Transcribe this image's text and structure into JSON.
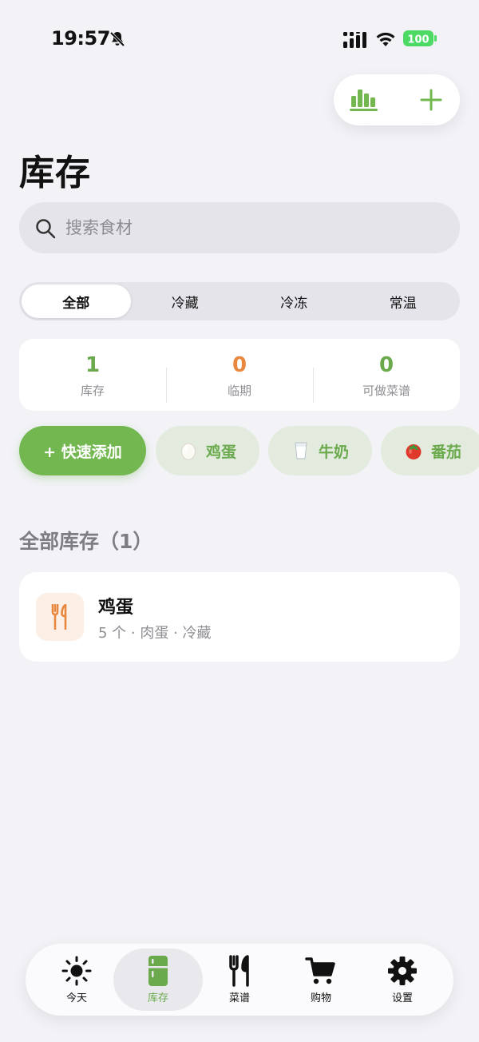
{
  "status_bar": {
    "time": "19:57",
    "battery": "100"
  },
  "page": {
    "title": "库存"
  },
  "search": {
    "placeholder": "搜索食材"
  },
  "segments": [
    {
      "label": "全部",
      "active": true
    },
    {
      "label": "冷藏",
      "active": false
    },
    {
      "label": "冷冻",
      "active": false
    },
    {
      "label": "常温",
      "active": false
    }
  ],
  "stats": [
    {
      "value": "1",
      "label": "库存",
      "color": "#6aaa4c"
    },
    {
      "value": "0",
      "label": "临期",
      "color": "#e8883e"
    },
    {
      "value": "0",
      "label": "可做菜谱",
      "color": "#6aaa4c"
    }
  ],
  "quick_add": {
    "label": "+ 快速添加",
    "chips": [
      {
        "label": "鸡蛋",
        "icon": "egg-icon"
      },
      {
        "label": "牛奶",
        "icon": "milk-icon"
      },
      {
        "label": "番茄",
        "icon": "tomato-icon"
      }
    ]
  },
  "section": {
    "title": "全部库存（1）"
  },
  "items": [
    {
      "name": "鸡蛋",
      "meta": "5 个 · 肉蛋 · 冷藏",
      "icon": "fork-knife-icon"
    }
  ],
  "tabbar": {
    "tabs": [
      {
        "label": "今天",
        "icon": "sun-icon",
        "active": false
      },
      {
        "label": "库存",
        "icon": "fridge-icon",
        "active": true
      },
      {
        "label": "菜谱",
        "icon": "fork-knife-icon",
        "active": false
      },
      {
        "label": "购物",
        "icon": "cart-icon",
        "active": false
      },
      {
        "label": "设置",
        "icon": "gear-icon",
        "active": false
      }
    ]
  },
  "colors": {
    "accent": "#72b750",
    "warning": "#e8883e",
    "background": "#f2f2f7"
  }
}
